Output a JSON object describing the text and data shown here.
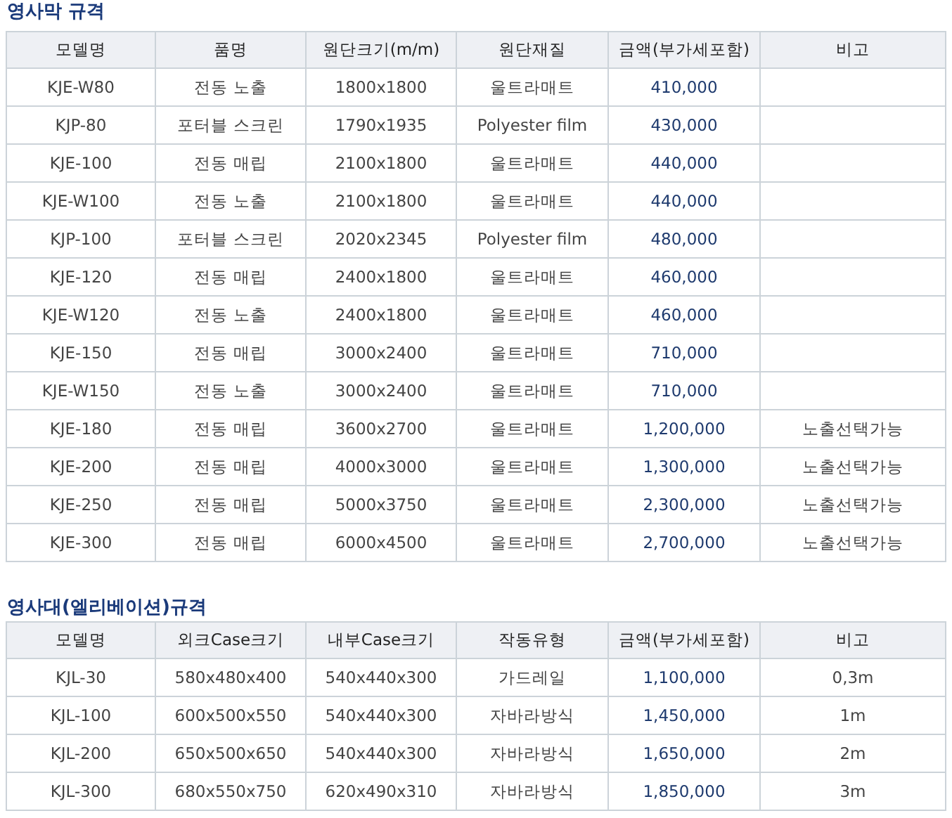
{
  "sections": [
    {
      "title": "영사막 규격",
      "columns": [
        "모델명",
        "품명",
        "원단크기(m/m)",
        "원단재질",
        "금액(부가세포함)",
        "비고"
      ],
      "rows": [
        [
          "KJE-W80",
          "전동 노출",
          "1800x1800",
          "울트라매트",
          "410,000",
          ""
        ],
        [
          "KJP-80",
          "포터블 스크린",
          "1790x1935",
          "Polyester film",
          "430,000",
          ""
        ],
        [
          "KJE-100",
          "전동 매립",
          "2100x1800",
          "울트라매트",
          "440,000",
          ""
        ],
        [
          "KJE-W100",
          "전동 노출",
          "2100x1800",
          "울트라매트",
          "440,000",
          ""
        ],
        [
          "KJP-100",
          "포터블 스크린",
          "2020x2345",
          "Polyester film",
          "480,000",
          ""
        ],
        [
          "KJE-120",
          "전동 매립",
          "2400x1800",
          "울트라매트",
          "460,000",
          ""
        ],
        [
          "KJE-W120",
          "전동 노출",
          "2400x1800",
          "울트라매트",
          "460,000",
          ""
        ],
        [
          "KJE-150",
          "전동 매립",
          "3000x2400",
          "울트라매트",
          "710,000",
          ""
        ],
        [
          "KJE-W150",
          "전동 노출",
          "3000x2400",
          "울트라매트",
          "710,000",
          ""
        ],
        [
          "KJE-180",
          "전동 매립",
          "3600x2700",
          "울트라매트",
          "1,200,000",
          "노출선택가능"
        ],
        [
          "KJE-200",
          "전동 매립",
          "4000x3000",
          "울트라매트",
          "1,300,000",
          "노출선택가능"
        ],
        [
          "KJE-250",
          "전동 매립",
          "5000x3750",
          "울트라매트",
          "2,300,000",
          "노출선택가능"
        ],
        [
          "KJE-300",
          "전동 매립",
          "6000x4500",
          "울트라매트",
          "2,700,000",
          "노출선택가능"
        ]
      ]
    },
    {
      "title": "영사대(엘리베이션)규격",
      "columns": [
        "모델명",
        "외크Case크기",
        "내부Case크기",
        "작동유형",
        "금액(부가세포함)",
        "비고"
      ],
      "rows": [
        [
          "KJL-30",
          "580x480x400",
          "540x440x300",
          "가드레일",
          "1,100,000",
          "0,3m"
        ],
        [
          "KJL-100",
          "600x500x550",
          "540x440x300",
          "자바라방식",
          "1,450,000",
          "1m"
        ],
        [
          "KJL-200",
          "650x500x650",
          "540x440x300",
          "자바라방식",
          "1,650,000",
          "2m"
        ],
        [
          "KJL-300",
          "680x550x750",
          "620x490x310",
          "자바라방식",
          "1,850,000",
          "3m"
        ]
      ]
    }
  ]
}
